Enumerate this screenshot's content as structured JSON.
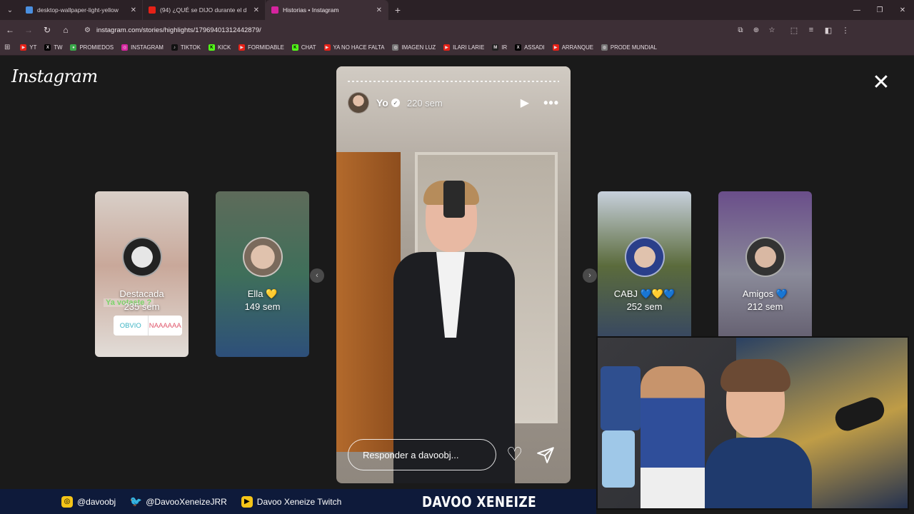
{
  "browser": {
    "tabs": [
      {
        "title": "desktop-wallpaper-light-yellow",
        "active": false,
        "fav_color": "#4a8fe0"
      },
      {
        "title": "(94) ¿QUÉ se DIJO durante el d",
        "active": false,
        "fav_color": "#e62117"
      },
      {
        "title": "Historias • Instagram",
        "active": true,
        "fav_color": "#d6249f"
      }
    ],
    "url": "instagram.com/stories/highlights/17969401312442879/",
    "bookmarks": [
      {
        "label": "YT",
        "color": "#e62117"
      },
      {
        "label": "TW",
        "color": "#000000"
      },
      {
        "label": "PROMIEDOS",
        "color": "#3aa84a"
      },
      {
        "label": "INSTAGRAM",
        "color": "#d6249f"
      },
      {
        "label": "TIKTOK",
        "color": "#111111"
      },
      {
        "label": "KICK",
        "color": "#53fc18"
      },
      {
        "label": "FORMIDABLE",
        "color": "#e62117"
      },
      {
        "label": "CHAT",
        "color": "#53fc18"
      },
      {
        "label": "YA NO HACE FALTA",
        "color": "#e62117"
      },
      {
        "label": "IMAGEN LUZ",
        "color": "#777777"
      },
      {
        "label": "ILARI LARIE",
        "color": "#e62117"
      },
      {
        "label": "IR",
        "color": "#222222"
      },
      {
        "label": "ASSADI",
        "color": "#000000"
      },
      {
        "label": "ARRANQUE",
        "color": "#e62117"
      },
      {
        "label": "PRODE MUNDIAL",
        "color": "#777777"
      }
    ]
  },
  "instagram": {
    "logo": "Instagram",
    "story": {
      "username": "Yo",
      "time": "220 sem",
      "reply_placeholder": "Responder a davoobj..."
    },
    "highlights_left": [
      {
        "label": "Destacada",
        "time": "235 sem",
        "sticker_question": "Ya votaste ?",
        "poll_yes": "OBVIO",
        "poll_no": "NAAAAAA"
      },
      {
        "label": "Ella 💛",
        "time": "149 sem"
      }
    ],
    "highlights_right": [
      {
        "label": "CABJ 💙💛💙",
        "time": "252 sem"
      },
      {
        "label": "Amigos 💙",
        "time": "212 sem"
      }
    ]
  },
  "stream": {
    "instagram_handle": "@davoobj",
    "twitter_handle": "@DavooXeneizeJRR",
    "twitch_name": "Davoo Xeneize Twitch",
    "brand": "DAVOO XENEIZE"
  }
}
